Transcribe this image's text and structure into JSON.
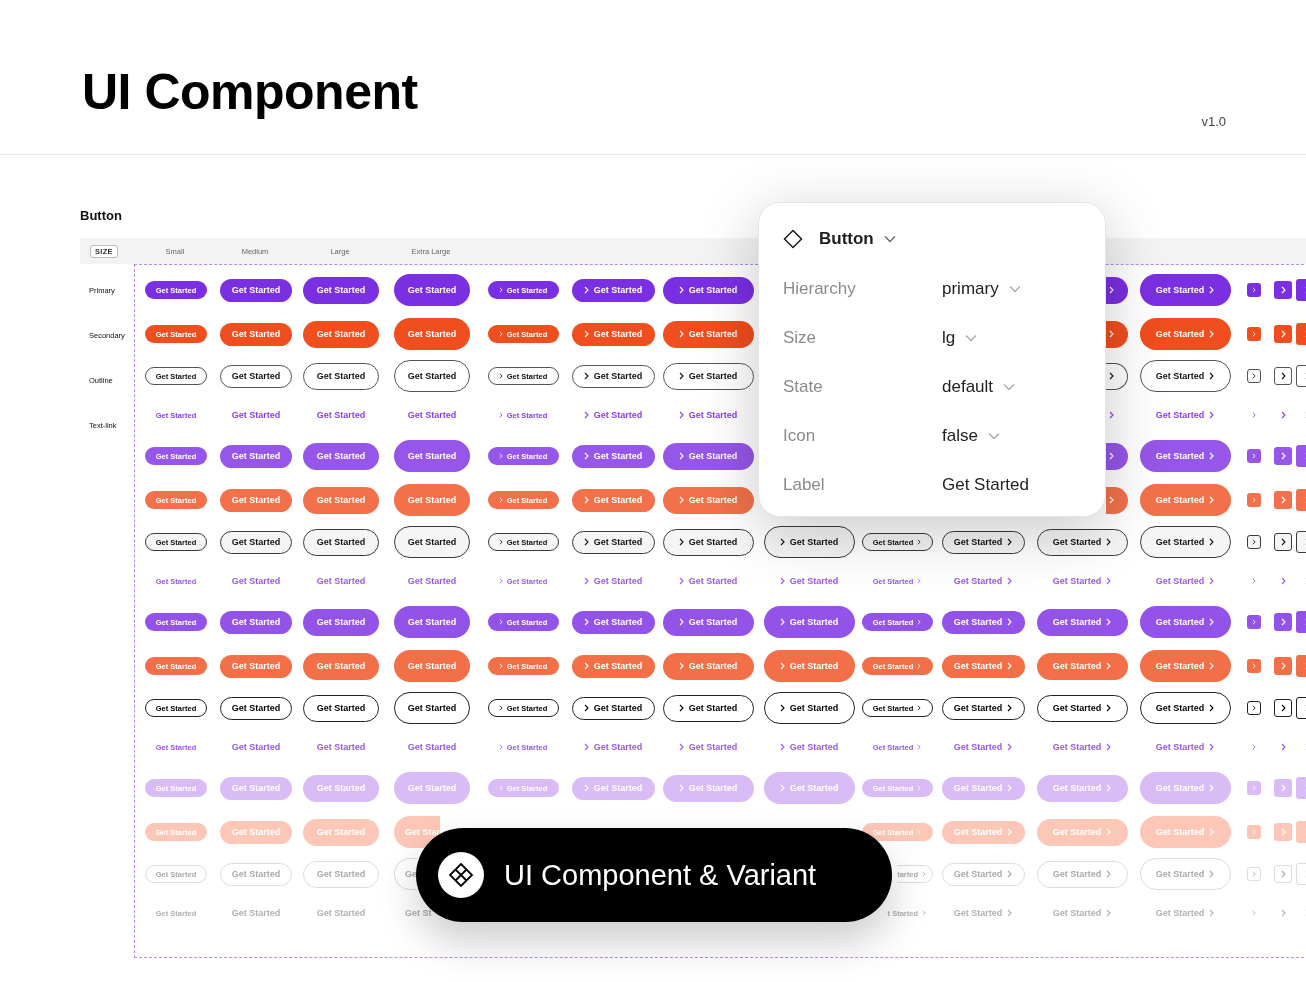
{
  "header": {
    "title": "UI Component",
    "version": "v1.0"
  },
  "section": {
    "title": "Button"
  },
  "size_header": {
    "badge": "SIZE",
    "labels": [
      "Small",
      "Medium",
      "Large",
      "Extra Large"
    ]
  },
  "row_labels": [
    "Primary",
    "Secondary",
    "Outline",
    "Text-link"
  ],
  "rows": [
    {
      "kind": "primary",
      "hovered": false,
      "pressed": false,
      "disabled": false,
      "cells": [
        "Get Started",
        "Get Started",
        "Get Started",
        "Get Started",
        "Get Started",
        "Get Started",
        "Get Started",
        null,
        null,
        null,
        {
          "clipped_start": true
        },
        "Get Started"
      ]
    },
    {
      "kind": "secondary",
      "hovered": false,
      "pressed": false,
      "disabled": false,
      "cells": [
        "Get Started",
        "Get Started",
        "Get Started",
        "Get Started",
        "Get Started",
        "Get Started",
        "Get Started",
        null,
        null,
        null,
        {
          "clipped_start": true
        },
        "Get Started"
      ]
    },
    {
      "kind": "outline",
      "hovered": false,
      "pressed": false,
      "disabled": false,
      "cells": [
        "Get Started",
        "Get Started",
        "Get Started",
        "Get Started",
        "Get Started",
        "Get Started",
        "Get Started",
        null,
        null,
        null,
        {
          "clipped_start": true
        },
        "Get Started"
      ]
    },
    {
      "kind": "link",
      "hovered": false,
      "pressed": false,
      "disabled": false,
      "cells": [
        "Get Started",
        "Get Started",
        "Get Started",
        "Get Started",
        "Get Started",
        "Get Started",
        "Get Started",
        null,
        null,
        null,
        {
          "clipped_start": true
        },
        "Get Started"
      ]
    },
    {
      "kind": "primary",
      "hovered": true,
      "pressed": false,
      "disabled": false,
      "cells": [
        "Get Started",
        "Get Started",
        "Get Started",
        "Get Started",
        "Get Started",
        "Get Started",
        "Get Started",
        null,
        null,
        null,
        {
          "clipped_start": true
        },
        "Get Started"
      ]
    },
    {
      "kind": "secondary",
      "hovered": true,
      "pressed": false,
      "disabled": false,
      "cells": [
        "Get Started",
        "Get Started",
        "Get Started",
        "Get Started",
        "Get Started",
        "Get Started",
        "Get Started",
        null,
        null,
        null,
        {
          "clipped_start": true
        },
        "Get Started"
      ]
    },
    {
      "kind": "outline",
      "hovered": true,
      "pressed": false,
      "disabled": false,
      "cells": [
        "Get Started",
        "Get Started",
        "Get Started",
        "Get Started",
        "Get Started",
        "Get Started",
        "Get Started",
        "Get Started",
        "Get Started",
        "Get Started",
        "Get Started",
        "Get Started"
      ]
    },
    {
      "kind": "link",
      "hovered": true,
      "pressed": false,
      "disabled": false,
      "cells": [
        "Get Started",
        "Get Started",
        "Get Started",
        "Get Started",
        "Get Started",
        "Get Started",
        "Get Started",
        "Get Started",
        "Get Started",
        "Get Started",
        "Get Started",
        "Get Started"
      ]
    },
    {
      "kind": "primary",
      "hovered": false,
      "pressed": true,
      "disabled": false,
      "cells": [
        "Get Started",
        "Get Started",
        "Get Started",
        "Get Started",
        "Get Started",
        "Get Started",
        "Get Started",
        "Get Started",
        "Get Started",
        "Get Started",
        "Get Started",
        "Get Started"
      ]
    },
    {
      "kind": "secondary",
      "hovered": false,
      "pressed": true,
      "disabled": false,
      "cells": [
        "Get Started",
        "Get Started",
        "Get Started",
        "Get Started",
        "Get Started",
        "Get Started",
        "Get Started",
        "Get Started",
        "Get Started",
        "Get Started",
        "Get Started",
        "Get Started"
      ]
    },
    {
      "kind": "outline",
      "hovered": false,
      "pressed": true,
      "disabled": false,
      "cells": [
        "Get Started",
        "Get Started",
        "Get Started",
        "Get Started",
        "Get Started",
        "Get Started",
        "Get Started",
        "Get Started",
        "Get Started",
        "Get Started",
        "Get Started",
        "Get Started"
      ]
    },
    {
      "kind": "link",
      "hovered": false,
      "pressed": true,
      "disabled": false,
      "cells": [
        "Get Started",
        "Get Started",
        "Get Started",
        "Get Started",
        "Get Started",
        "Get Started",
        "Get Started",
        "Get Started",
        "Get Started",
        "Get Started",
        "Get Started",
        "Get Started"
      ]
    },
    {
      "kind": "primary",
      "hovered": false,
      "pressed": false,
      "disabled": true,
      "cells": [
        "Get Started",
        "Get Started",
        "Get Started",
        "Get Started",
        "Get Started",
        "Get Started",
        "Get Started",
        "Get Started",
        "Get Started",
        "Get Started",
        "Get Started",
        "Get Started"
      ]
    },
    {
      "kind": "secondary",
      "hovered": false,
      "pressed": false,
      "disabled": true,
      "cells": [
        "Get Started",
        "Get Started",
        "Get Started",
        {
          "label": "Get Star",
          "clipped_end": true
        },
        null,
        null,
        null,
        null,
        "Get Started",
        "Get Started",
        "Get Started",
        "Get Started"
      ]
    },
    {
      "kind": "outline",
      "hovered": false,
      "pressed": false,
      "disabled": true,
      "cells": [
        "Get Started",
        "Get Started",
        "Get Started",
        {
          "label": "Ge",
          "clipped_end": true
        },
        null,
        null,
        null,
        null,
        {
          "label": "tarted",
          "clipped_start": true
        },
        "Get Started",
        "Get Started",
        "Get Started"
      ]
    },
    {
      "kind": "link",
      "hovered": false,
      "pressed": false,
      "disabled": true,
      "cells": [
        "Get Started",
        "Get Started",
        "Get Started",
        {
          "label": "Get St",
          "clipped_end": true
        },
        null,
        null,
        null,
        null,
        {
          "label": "t Started",
          "clipped_start": true
        },
        "Get Started",
        "Get Started",
        "Get Started"
      ]
    }
  ],
  "properties_panel": {
    "title": "Button",
    "properties": [
      {
        "name": "Hierarchy",
        "value": "primary",
        "kind": "dropdown"
      },
      {
        "name": "Size",
        "value": "lg",
        "kind": "dropdown"
      },
      {
        "name": "State",
        "value": "default",
        "kind": "dropdown"
      },
      {
        "name": "Icon",
        "value": "false",
        "kind": "dropdown"
      },
      {
        "name": "Label",
        "value": "Get Started",
        "kind": "text"
      }
    ]
  },
  "toast": {
    "text": "UI Component & Variant"
  }
}
